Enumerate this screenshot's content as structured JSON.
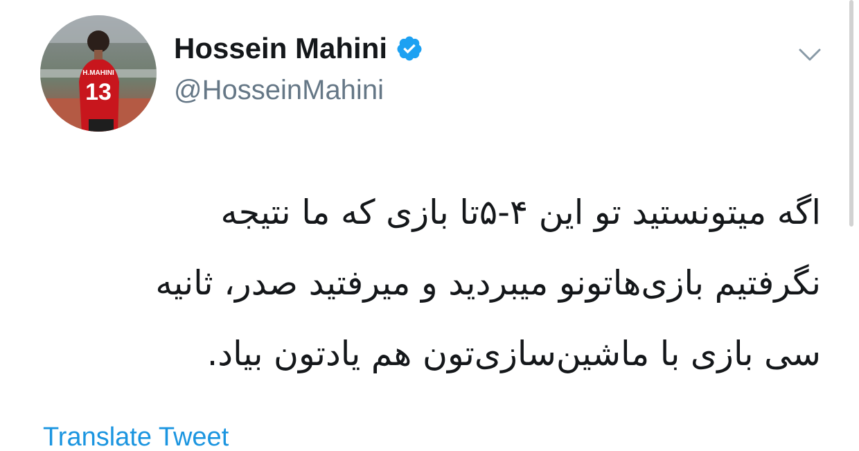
{
  "tweet": {
    "author": {
      "display_name": "Hossein Mahini",
      "handle": "@HosseinMahini",
      "verified": true,
      "avatar": {
        "jersey_name": "H.MAHINI",
        "jersey_number": "13",
        "jersey_color": "#c8161d"
      }
    },
    "text_lines": [
      "اگه میتونستید تو این ۴-۵تا بازی که ما نتیجه",
      "نگرفتیم بازی‌هاتونو میبردید و میرفتید صدر، ثانیه",
      "سی بازی با ماشین‌سازی‌تون هم یادتون بیاد."
    ],
    "translate_label": "Translate Tweet"
  },
  "icons": {
    "verified": "verified-badge-icon",
    "menu": "chevron-down-icon"
  },
  "colors": {
    "text": "#14171a",
    "secondary": "#657786",
    "link": "#1b95e0",
    "verified": "#1da1f2"
  }
}
